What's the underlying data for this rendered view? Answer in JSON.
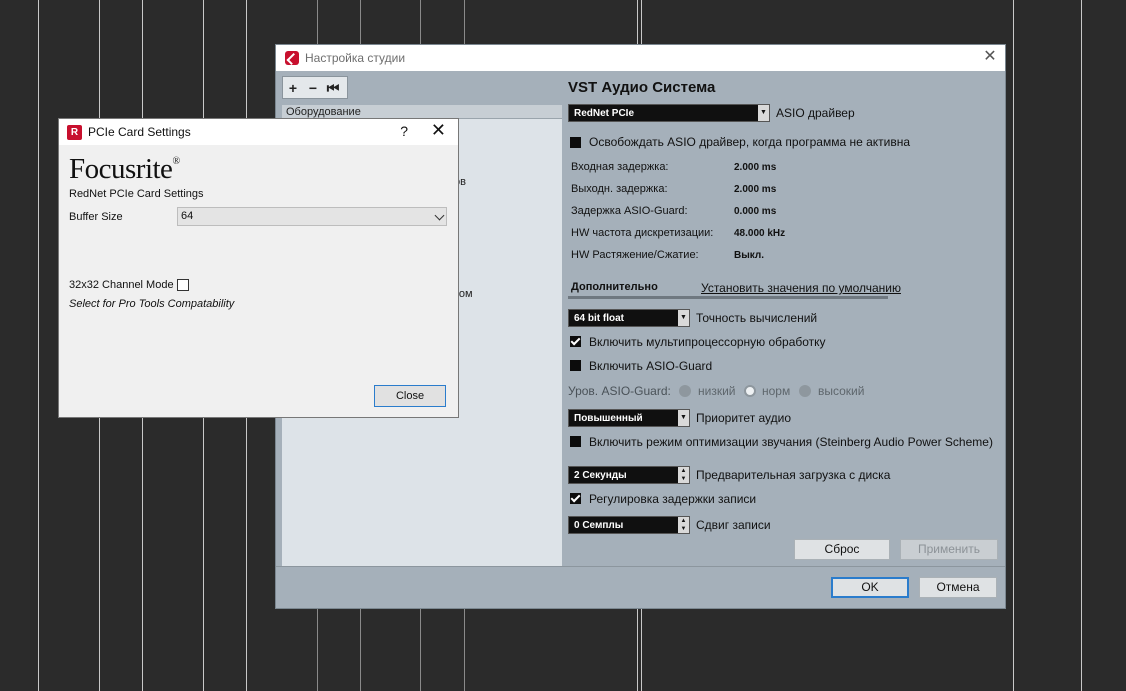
{
  "studio": {
    "title": "Настройка студии",
    "tree_header": "Оборудование",
    "tree_partial_1": "ов",
    "tree_partial_2": "ком",
    "vst_title": "VST Аудио Система",
    "driver_select": "RedNet PCIe",
    "driver_label": "ASIO драйвер",
    "release_driver_label": "Освобождать ASIO драйвер, когда программа не активна",
    "stats": [
      {
        "label": "Входная задержка:",
        "value": "2.000 ms"
      },
      {
        "label": "Выходн. задержка:",
        "value": "2.000 ms"
      },
      {
        "label": "Задержка ASIO-Guard:",
        "value": "0.000 ms"
      },
      {
        "label": "HW частота дискретизации:",
        "value": "48.000 kHz"
      },
      {
        "label": "HW Растяжение/Сжатие:",
        "value": "Выкл."
      }
    ],
    "advanced_label": "Дополнительно",
    "defaults_link": "Установить значения по умолчанию",
    "precision_select": "64 bit float",
    "precision_label": "Точность вычислений",
    "multiproc_label": "Включить мультипроцессорную обработку",
    "asio_guard_label": "Включить ASIO-Guard",
    "guard_level_label": "Уров. ASIO-Guard:",
    "guard_levels": [
      "низкий",
      "норм",
      "высокий"
    ],
    "priority_select": "Повышенный",
    "priority_label": "Приоритет аудио",
    "power_scheme_label": "Включить режим оптимизации звучания (Steinberg Audio Power Scheme)",
    "preload_select": "2 Секунды",
    "preload_label": "Предварительная загрузка с диска",
    "latency_adjust_label": "Регулировка задержки записи",
    "offset_select": "0 Семплы",
    "offset_label": "Сдвиг записи",
    "reset_button": "Сброс",
    "apply_button": "Применить",
    "ok_button": "OK",
    "cancel_button": "Отмена"
  },
  "pcie": {
    "title": "PCIe Card Settings",
    "help": "?",
    "brand": "Focusrite",
    "brand_mark": "®",
    "subtitle": "RedNet PCIe Card Settings",
    "buffer_label": "Buffer Size",
    "buffer_value": "64",
    "channel_mode_label": "32x32 Channel Mode",
    "hint": "Select for Pro Tools Compatability",
    "close_button": "Close"
  }
}
